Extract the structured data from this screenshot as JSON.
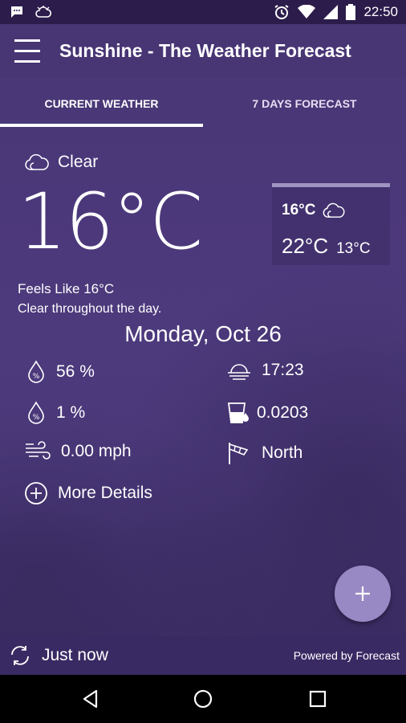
{
  "status_bar": {
    "time": "22:50",
    "icons": [
      "message-icon",
      "weather-alert-icon",
      "alarm-icon",
      "wifi-icon",
      "signal-icon",
      "battery-icon"
    ]
  },
  "app_bar": {
    "title": "Sunshine - The Weather Forecast"
  },
  "tabs": [
    {
      "label": "CURRENT WEATHER",
      "selected": true
    },
    {
      "label": "7 DAYS FORECAST",
      "selected": false
    }
  ],
  "current": {
    "condition": "Clear",
    "temperature": "16°C",
    "feels_like": "Feels Like 16°C",
    "summary": "Clear throughout the day.",
    "date": "Monday, Oct 26"
  },
  "minmax": {
    "current": "16°C",
    "high": "22°C",
    "low": "13°C"
  },
  "details": {
    "humidity": "56 %",
    "sunset": "17:23",
    "precip_probability": "1 %",
    "precip_intensity": "0.0203",
    "wind_speed": "0.00 mph",
    "wind_direction": "North"
  },
  "more_details_label": "More Details",
  "footer": {
    "refresh_label": "Just now",
    "powered_by": "Powered by Forecast"
  },
  "colors": {
    "accent": "#9889c4",
    "app_bar": "#473574",
    "status_bar": "#2c1c4b"
  }
}
